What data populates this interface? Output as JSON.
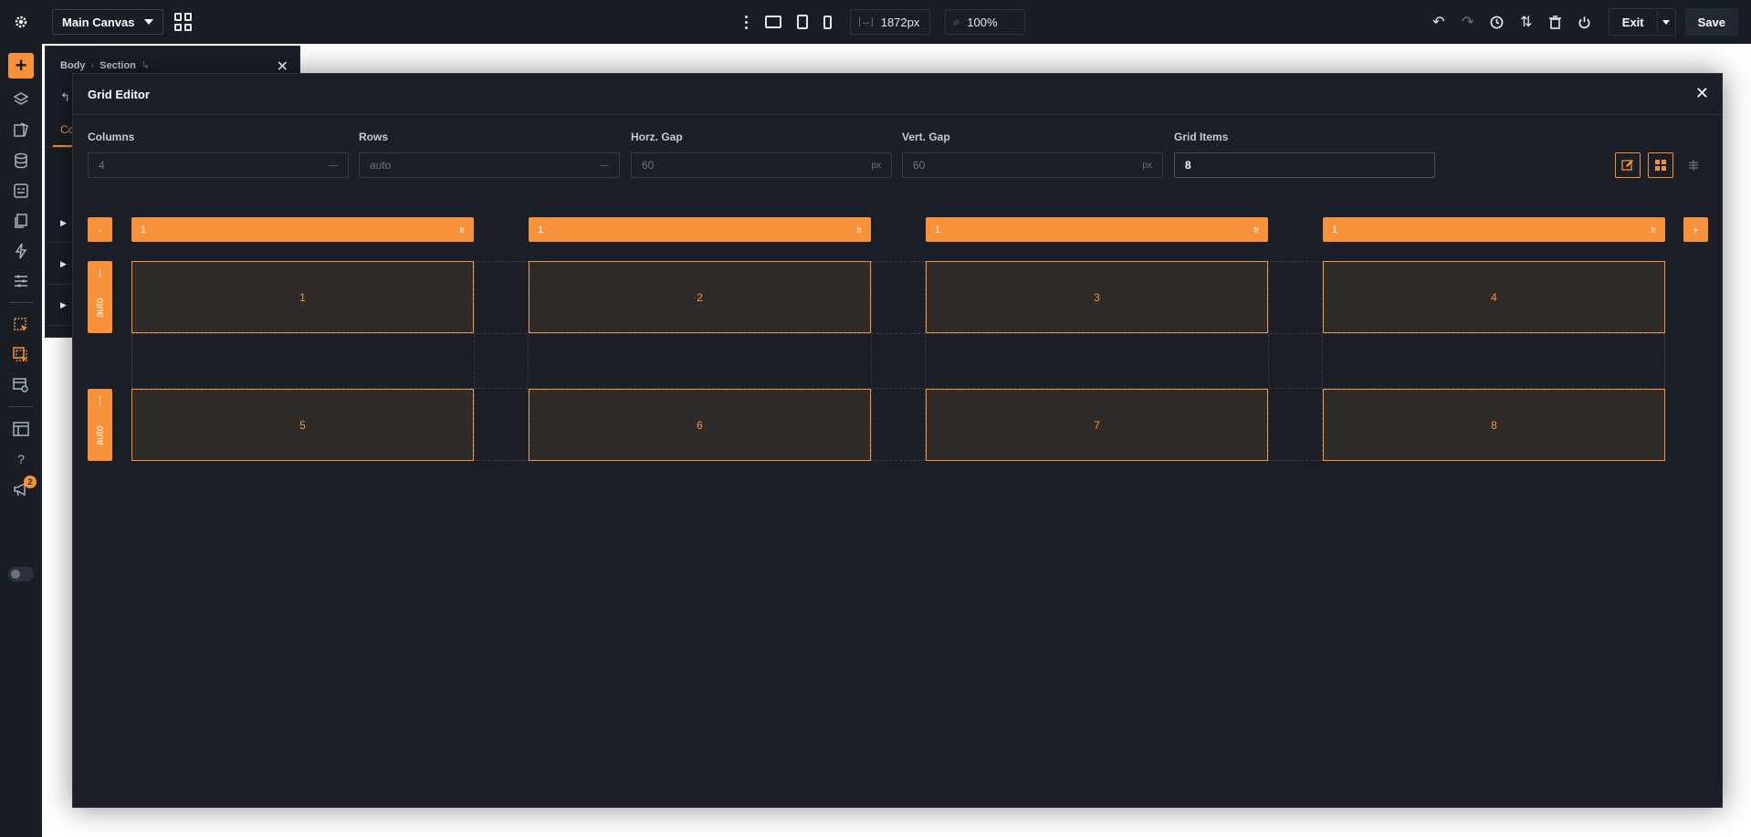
{
  "topbar": {
    "canvas_select": "Main Canvas",
    "width_value": "1872px",
    "zoom_value": "100%",
    "exit_label": "Exit",
    "save_label": "Save"
  },
  "panel": {
    "breadcrumb": [
      "Body",
      "Section"
    ],
    "tab_label": "Co"
  },
  "sidebar": {
    "notification_count": "2"
  },
  "grid_editor": {
    "title": "Grid Editor",
    "fields": {
      "columns": {
        "label": "Columns",
        "value": "4"
      },
      "rows": {
        "label": "Rows",
        "value": "auto"
      },
      "horz_gap": {
        "label": "Horz. Gap",
        "value": "60",
        "unit": "px"
      },
      "vert_gap": {
        "label": "Vert. Gap",
        "value": "60",
        "unit": "px"
      },
      "grid_items": {
        "label": "Grid Items",
        "value": "8"
      }
    },
    "remove_label": "-",
    "add_label": "+",
    "columns": [
      {
        "value": "1",
        "unit": "fr"
      },
      {
        "value": "1",
        "unit": "fr"
      },
      {
        "value": "1",
        "unit": "fr"
      },
      {
        "value": "1",
        "unit": "fr"
      }
    ],
    "rows": [
      {
        "value": "auto"
      },
      {
        "value": "auto"
      }
    ],
    "items": [
      "1",
      "2",
      "3",
      "4",
      "5",
      "6",
      "7",
      "8"
    ]
  },
  "colors": {
    "accent": "#f7923a",
    "background": "#1b1f27",
    "cell_fill": "#2f2b29"
  }
}
